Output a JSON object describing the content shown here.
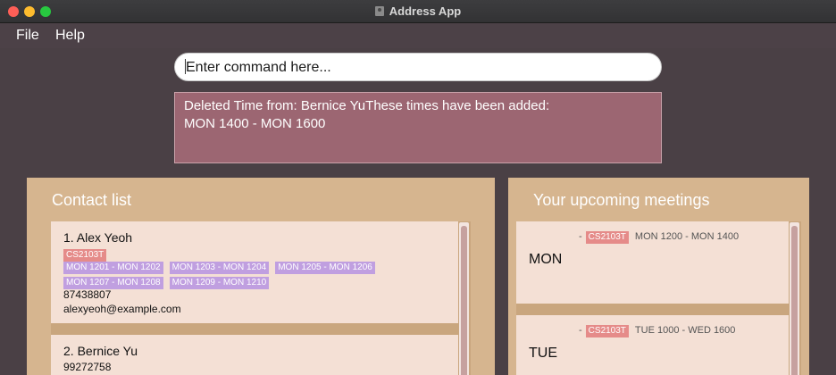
{
  "window": {
    "title": "Address App"
  },
  "menu": {
    "file": "File",
    "help": "Help"
  },
  "command": {
    "placeholder": "Enter command here..."
  },
  "result": {
    "line1": "Deleted Time from: Bernice YuThese times have been added:",
    "line2": "MON 1400 - MON 1600"
  },
  "contacts": {
    "title": "Contact list",
    "items": [
      {
        "name": "1.  Alex Yeoh",
        "tag": "CS2103T",
        "times_row1": [
          "MON 1201 - MON 1202",
          "MON 1203 - MON 1204",
          "MON 1205 - MON 1206"
        ],
        "times_row2": [
          "MON 1207 - MON 1208",
          "MON 1209 - MON 1210"
        ],
        "phone": "87438807",
        "email": "alexyeoh@example.com"
      },
      {
        "name": "2.  Bernice Yu",
        "phone": "99272758"
      }
    ]
  },
  "meetings": {
    "title": "Your upcoming meetings",
    "items": [
      {
        "day": "MON",
        "dash": "-",
        "tag": "CS2103T",
        "time": "MON 1200 - MON 1400"
      },
      {
        "day": "TUE",
        "dash": "-",
        "tag": "CS2103T",
        "time": "TUE 1000 - WED 1600"
      }
    ]
  },
  "colors": {
    "module_tag": "#e58b89",
    "time_tag": "#c09fe0",
    "panel": "#d6b58f",
    "result_box": "#9c6672"
  }
}
